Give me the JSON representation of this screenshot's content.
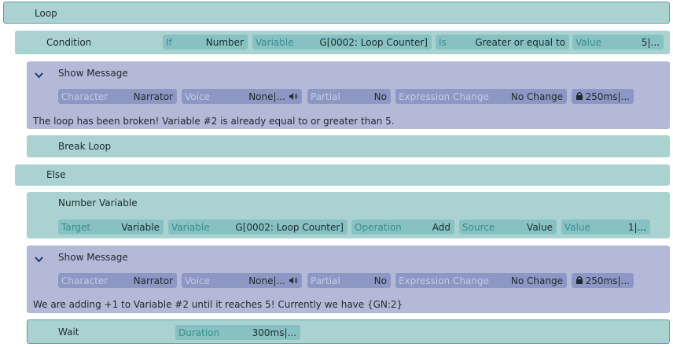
{
  "loop": {
    "title": "Loop"
  },
  "condition": {
    "title": "Condition",
    "if": {
      "label": "If",
      "value": "Number"
    },
    "variable": {
      "label": "Variable",
      "value": "G[0002: Loop Counter]"
    },
    "is": {
      "label": "Is",
      "value": "Greater or equal to"
    },
    "value": {
      "label": "Value",
      "value": "5|..."
    }
  },
  "message1": {
    "title": "Show Message",
    "character": {
      "label": "Character",
      "value": "Narrator"
    },
    "voice": {
      "label": "Voice",
      "value": "None|..."
    },
    "partial": {
      "label": "Partial",
      "value": "No"
    },
    "expression": {
      "label": "Expression Change",
      "value": "No Change"
    },
    "speed": {
      "value": "250ms|..."
    },
    "text": "The loop has been broken! Variable #2 is already equal to or greater than 5."
  },
  "break_loop": {
    "title": "Break Loop"
  },
  "else": {
    "title": "Else"
  },
  "number_variable": {
    "title": "Number Variable",
    "target": {
      "label": "Target",
      "value": "Variable"
    },
    "variable": {
      "label": "Variable",
      "value": "G[0002: Loop Counter]"
    },
    "operation": {
      "label": "Operation",
      "value": "Add"
    },
    "source": {
      "label": "Source",
      "value": "Value"
    },
    "value": {
      "label": "Value",
      "value": "1|..."
    }
  },
  "message2": {
    "title": "Show Message",
    "character": {
      "label": "Character",
      "value": "Narrator"
    },
    "voice": {
      "label": "Voice",
      "value": "None|..."
    },
    "partial": {
      "label": "Partial",
      "value": "No"
    },
    "expression": {
      "label": "Expression Change",
      "value": "No Change"
    },
    "speed": {
      "value": "250ms|..."
    },
    "text": "We are adding +1 to Variable #2 until it reaches 5! Currently we have {GN:2}"
  },
  "wait": {
    "title": "Wait",
    "duration": {
      "label": "Duration",
      "value": "300ms|..."
    }
  },
  "icons": {
    "collapse": "chevron-down-icon",
    "voice": "speaker-icon",
    "speed": "lock-icon"
  },
  "colors": {
    "teal_bg": "#a9d2d1",
    "teal_pill": "#87c1c2",
    "lavender_bg": "#b4b9d8",
    "lavender_pill": "#8d97c4",
    "border": "#5f9ea3"
  }
}
